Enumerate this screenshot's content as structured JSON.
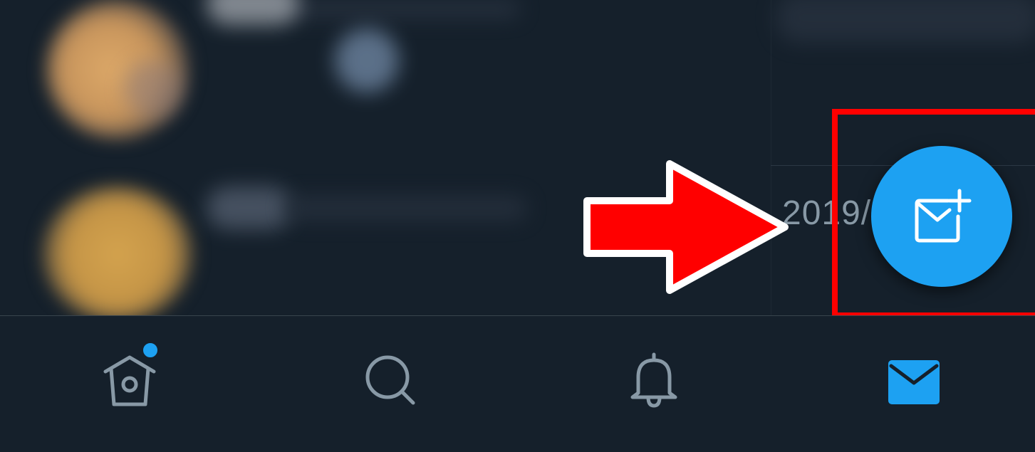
{
  "message_list": {
    "visible_date_text": "2019/"
  },
  "compose": {
    "icon": "new-message-icon"
  },
  "tab_bar": {
    "tabs": [
      {
        "id": "home",
        "icon": "home-icon",
        "has_badge": true,
        "active": false
      },
      {
        "id": "search",
        "icon": "search-icon",
        "active": false
      },
      {
        "id": "notifications",
        "icon": "bell-icon",
        "active": false
      },
      {
        "id": "messages",
        "icon": "mail-icon",
        "active": true
      }
    ]
  },
  "annotation": {
    "arrow_icon": "arrow-right-icon",
    "highlight_color": "#ff0000"
  },
  "colors": {
    "background": "#15202b",
    "accent": "#1da1f2",
    "inactive_icon": "#8899a6",
    "divider": "#38444d"
  }
}
